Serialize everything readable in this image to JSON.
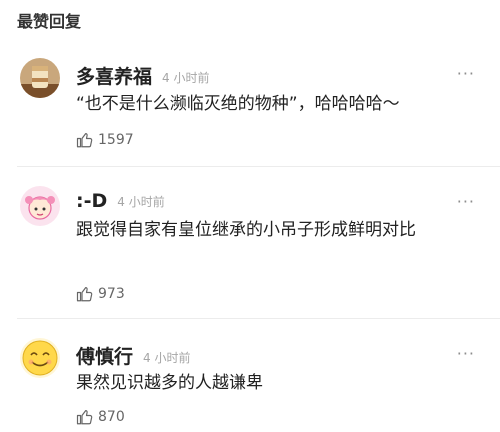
{
  "section_title": "最赞回复",
  "comments": [
    {
      "avatar_icon": "cake-photo-avatar",
      "name": "多喜养福",
      "time": "4 小时前",
      "text": "“也不是什么濒临灭绝的物种”，哈哈哈哈～",
      "likes": "1597",
      "more": "···"
    },
    {
      "avatar_icon": "cartoon-girl-avatar",
      "name": ":-D",
      "time": "4 小时前",
      "text": "跟觉得自家有皇位继承的小吊子形成鲜明对比",
      "likes": "973",
      "more": "···"
    },
    {
      "avatar_icon": "smiley-face-avatar",
      "name": "傅慎行",
      "time": "4 小时前",
      "text": "果然见识越多的人越谦卑",
      "likes": "870",
      "more": "···"
    }
  ],
  "colors": {
    "text": "#222222",
    "secondary": "#a6a6a6",
    "divider": "#ececec"
  }
}
